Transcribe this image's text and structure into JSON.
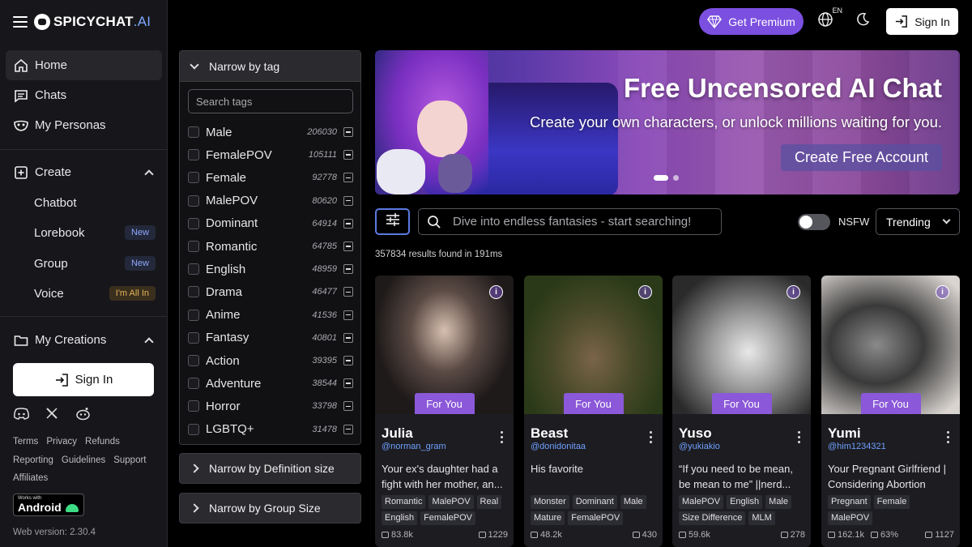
{
  "brand": {
    "logo_main": "SPICYCHAT",
    "logo_suffix": ".AI"
  },
  "sidebar": {
    "home": "Home",
    "chats": "Chats",
    "personas": "My Personas",
    "create": "Create",
    "create_items": [
      {
        "label": "Chatbot",
        "badge": ""
      },
      {
        "label": "Lorebook",
        "badge": "New"
      },
      {
        "label": "Group",
        "badge": "New"
      },
      {
        "label": "Voice",
        "badge": "I'm All In"
      }
    ],
    "my_creations": "My Creations",
    "signin": "Sign In",
    "socials": [
      "discord-icon",
      "x-icon",
      "reddit-icon"
    ],
    "footer_links": [
      "Terms",
      "Privacy",
      "Refunds",
      "Reporting",
      "Guidelines",
      "Support",
      "Affiliates"
    ],
    "android_small": "Works with",
    "android_big": "Android",
    "version": "Web version: 2.30.4"
  },
  "topbar": {
    "premium": "Get Premium",
    "lang": "EN",
    "signin": "Sign In"
  },
  "filters": {
    "tag_header": "Narrow by tag",
    "tag_search_placeholder": "Search tags",
    "tags": [
      {
        "name": "Male",
        "count": "206030"
      },
      {
        "name": "FemalePOV",
        "count": "105111"
      },
      {
        "name": "Female",
        "count": "92778"
      },
      {
        "name": "MalePOV",
        "count": "80620"
      },
      {
        "name": "Dominant",
        "count": "64914"
      },
      {
        "name": "Romantic",
        "count": "64785"
      },
      {
        "name": "English",
        "count": "48959"
      },
      {
        "name": "Drama",
        "count": "46477"
      },
      {
        "name": "Anime",
        "count": "41536"
      },
      {
        "name": "Fantasy",
        "count": "40801"
      },
      {
        "name": "Action",
        "count": "39395"
      },
      {
        "name": "Adventure",
        "count": "38544"
      },
      {
        "name": "Horror",
        "count": "33798"
      },
      {
        "name": "LGBTQ+",
        "count": "31478"
      }
    ],
    "definition_size": "Narrow by Definition size",
    "group_size": "Narrow by Group Size"
  },
  "banner": {
    "title": "Free Uncensored AI Chat",
    "tagline": "Create your own characters, or unlock millions waiting for you.",
    "cta": "Create Free Account"
  },
  "search": {
    "placeholder": "Dive into endless fantasies - start searching!",
    "nsfw_label": "NSFW",
    "nsfw_on": false,
    "sort": "Trending",
    "results": "357834 results found in 191ms"
  },
  "cards": [
    {
      "badge": "For You",
      "name": "Julia",
      "handle": "@norman_gram",
      "desc": "Your ex's daughter had a fight with her mother, an...",
      "tags": [
        "Romantic",
        "MalePOV",
        "Real",
        "English",
        "FemalePOV"
      ],
      "chats": "83.8k",
      "rating": "",
      "count": "1229"
    },
    {
      "badge": "For You",
      "name": "Beast",
      "handle": "@donidonitaa",
      "desc": "His favorite",
      "tags": [
        "Monster",
        "Dominant",
        "Male",
        "Mature",
        "FemalePOV"
      ],
      "chats": "48.2k",
      "rating": "",
      "count": "430"
    },
    {
      "badge": "For You",
      "name": "Yuso",
      "handle": "@yukiakio",
      "desc": "“If you need to be mean, be mean to me” ||nerd...",
      "tags": [
        "MalePOV",
        "English",
        "Male",
        "Size Difference",
        "MLM"
      ],
      "chats": "59.6k",
      "rating": "",
      "count": "278"
    },
    {
      "badge": "For You",
      "name": "Yumi",
      "handle": "@him1234321",
      "desc": "Your Pregnant Girlfriend | Considering Abortion",
      "tags": [
        "Pregnant",
        "Female",
        "MalePOV"
      ],
      "chats": "162.1k",
      "rating": "63%",
      "count": "1127"
    }
  ]
}
